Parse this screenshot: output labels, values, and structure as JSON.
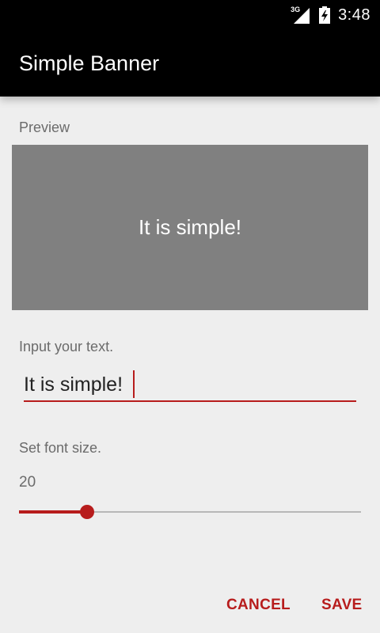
{
  "status_bar": {
    "network": "3G",
    "time": "3:48",
    "icons": [
      "signal-icon",
      "battery-charging-icon"
    ]
  },
  "toolbar": {
    "title": "Simple Banner"
  },
  "preview": {
    "label": "Preview",
    "text": "It is simple!"
  },
  "input": {
    "label": "Input your text.",
    "value": "It is simple!"
  },
  "font_size": {
    "label": "Set font size.",
    "value": "20",
    "slider_fraction": 0.2
  },
  "actions": {
    "cancel": "CANCEL",
    "save": "SAVE"
  },
  "colors": {
    "accent": "#b71c1c",
    "preview_bg": "#808080",
    "background": "#eeeeee",
    "toolbar": "#000000"
  }
}
